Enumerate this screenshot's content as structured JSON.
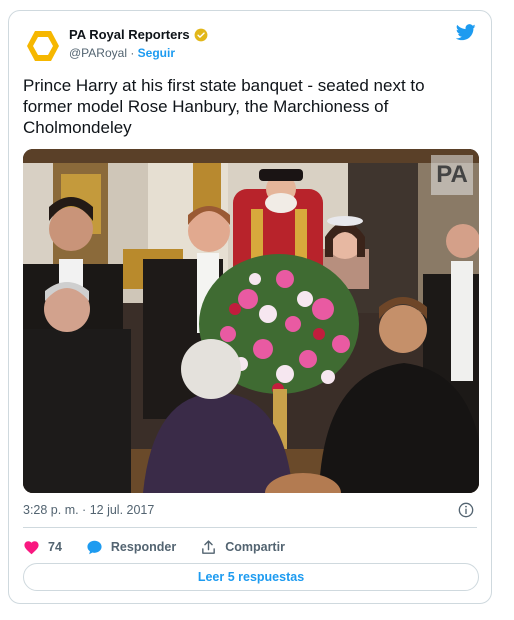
{
  "account": {
    "name": "PA Royal Reporters",
    "handle": "@PARoyal",
    "separator": "·",
    "follow_label": "Seguir"
  },
  "tweet": {
    "text": "Prince Harry at his first state banquet - seated next to former model Rose Hanbury, the Marchioness of Cholmondeley",
    "photo_watermark": "PA",
    "timestamp": "3:28 p. m. · 12 jul. 2017"
  },
  "actions": {
    "like_count": "74",
    "reply_label": "Responder",
    "share_label": "Compartir"
  },
  "footer": {
    "read_replies_label": "Leer 5 respuestas"
  },
  "colors": {
    "accent": "#1d9bf0",
    "like": "#f91880",
    "avatar": "#f6b700",
    "verified": "#e2b719"
  },
  "icons": [
    "avatar-logo-icon",
    "verified-badge-icon",
    "twitter-bird-icon",
    "info-icon",
    "heart-icon",
    "reply-bubble-icon",
    "share-icon"
  ]
}
